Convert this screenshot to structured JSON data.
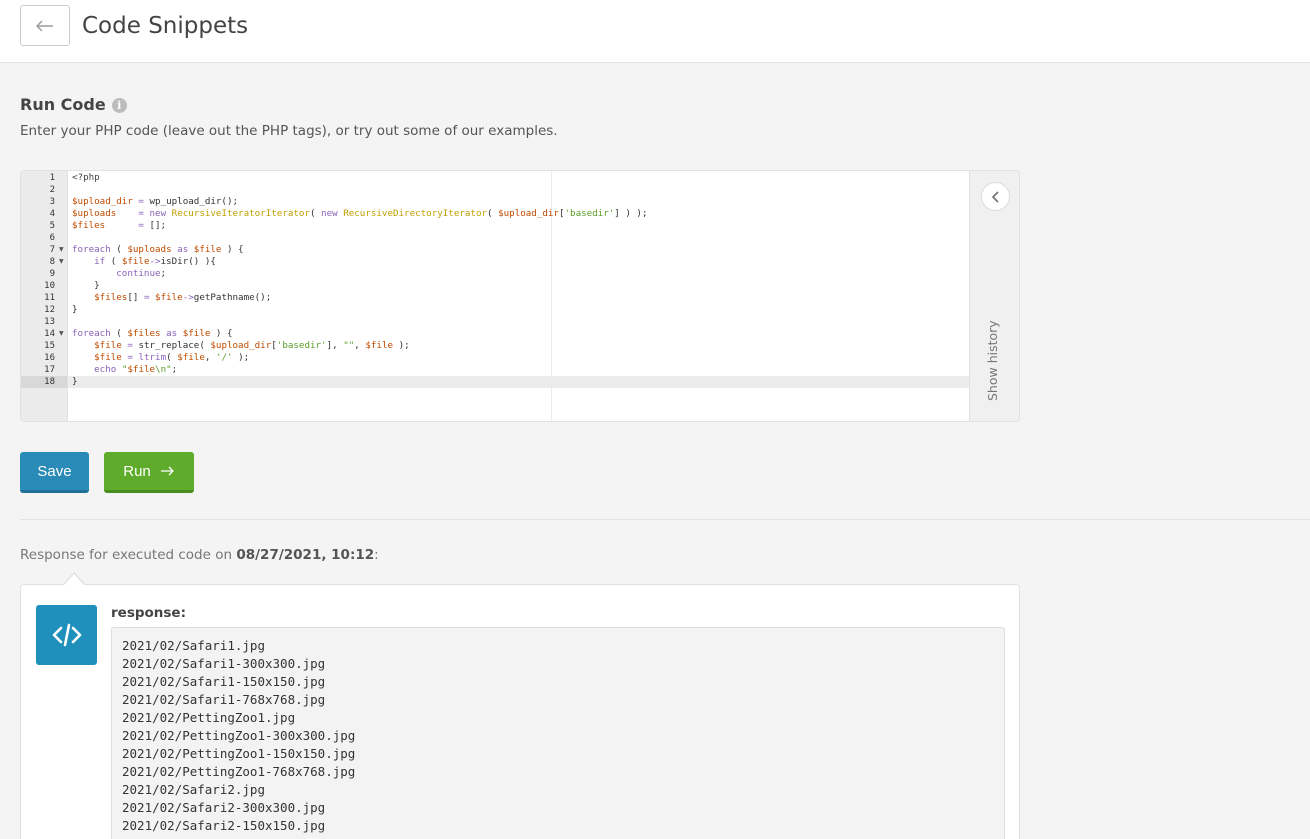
{
  "header": {
    "title": "Code Snippets",
    "back_icon": "arrow-left-icon"
  },
  "run_code": {
    "title": "Run Code",
    "info_icon": "i",
    "subtitle": "Enter your PHP code (leave out the PHP tags), or try out some of our examples."
  },
  "editor": {
    "line_numbers": [
      "1",
      "2",
      "3",
      "4",
      "5",
      "6",
      "7",
      "8",
      "9",
      "10",
      "11",
      "12",
      "13",
      "14",
      "15",
      "16",
      "17",
      "18"
    ],
    "fold_lines": [
      7,
      8,
      14
    ],
    "active_line": 18,
    "history_label": "Show history"
  },
  "buttons": {
    "save": "Save",
    "run": "Run"
  },
  "response": {
    "prefix": "Response for executed code on ",
    "datetime": "08/27/2021, 10:12",
    "suffix": ":",
    "label": "response:",
    "output": "2021/02/Safari1.jpg\n2021/02/Safari1-300x300.jpg\n2021/02/Safari1-150x150.jpg\n2021/02/Safari1-768x768.jpg\n2021/02/PettingZoo1.jpg\n2021/02/PettingZoo1-300x300.jpg\n2021/02/PettingZoo1-150x150.jpg\n2021/02/PettingZoo1-768x768.jpg\n2021/02/Safari2.jpg\n2021/02/Safari2-300x300.jpg\n2021/02/Safari2-150x150.jpg"
  },
  "colors": {
    "save_button": "#2a8ab8",
    "run_button": "#5fac2d",
    "code_icon_bg": "#1f8fbb",
    "var": "#c14b00",
    "keyword": "#8a61b8",
    "class": "#c0a000",
    "string": "#5a9e28"
  }
}
